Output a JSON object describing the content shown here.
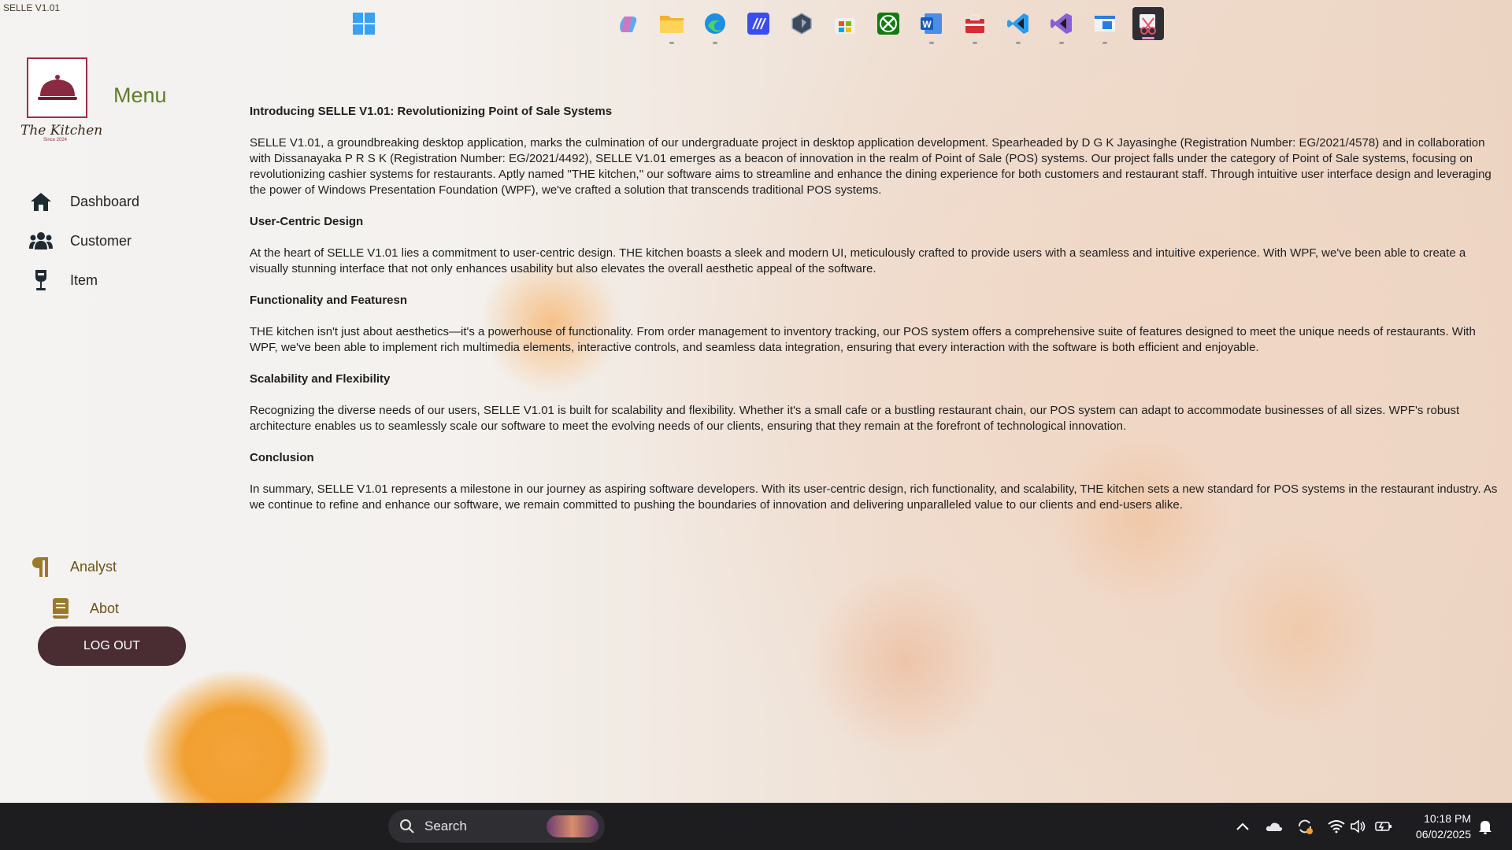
{
  "app": {
    "title": "SELLE V1.01"
  },
  "sidebar": {
    "logo_text": "The Kitchen",
    "logo_sub": "Since 2024",
    "menu_title": "Menu",
    "items": [
      {
        "label": "Dashboard",
        "icon": "home-icon"
      },
      {
        "label": "Customer",
        "icon": "users-icon"
      },
      {
        "label": "Item",
        "icon": "wine-glass-icon"
      }
    ],
    "bottom_items": [
      {
        "label": "Analyst",
        "icon": "paragraph-icon"
      },
      {
        "label": "Abot",
        "icon": "book-icon"
      }
    ],
    "logout_label": "LOG OUT"
  },
  "content": {
    "heading": "Introducing SELLE V1.01: Revolutionizing Point of Sale Systems",
    "intro": "SELLE V1.01, a groundbreaking desktop application, marks the culmination of our undergraduate project in desktop application development. Spearheaded by D G K Jayasinghe (Registration Number: EG/2021/4578) and in collaboration with Dissanayaka P R S K (Registration Number: EG/2021/4492), SELLE V1.01 emerges as a beacon of innovation in the realm of Point of Sale (POS) systems. Our project falls under the category of Point of Sale systems, focusing on revolutionizing cashier systems for restaurants. Aptly named \"THE kitchen,\" our software aims to streamline and enhance the dining experience for both customers and restaurant staff. Through intuitive user interface design and leveraging the power of Windows Presentation Foundation (WPF), we've crafted a solution that transcends traditional POS systems.",
    "sections": [
      {
        "title": "User-Centric Design",
        "body": "At the heart of SELLE V1.01 lies a commitment to user-centric design. THE kitchen boasts a sleek and modern UI, meticulously crafted to provide users with a seamless and intuitive experience. With WPF, we've been able to create a visually stunning interface that not only enhances usability but also elevates the overall aesthetic appeal of the software."
      },
      {
        "title": "Functionality and Featuresn",
        "body": "THE kitchen isn't just about aesthetics—it's a powerhouse of functionality. From order management to inventory tracking, our POS system offers a comprehensive suite of features designed to meet the unique needs of restaurants. With WPF, we've been able to implement rich multimedia elements, interactive controls, and seamless data integration, ensuring that every interaction with the software is both efficient and enjoyable."
      },
      {
        "title": "Scalability and Flexibility",
        "body": "Recognizing the diverse needs of our users, SELLE V1.01 is built for scalability and flexibility. Whether it's a small cafe or a bustling restaurant chain, our POS system can adapt to accommodate businesses of all sizes. WPF's robust architecture enables us to seamlessly scale our software to meet the evolving needs of our clients, ensuring that they remain at the forefront of technological innovation."
      },
      {
        "title": "Conclusion",
        "body": "In summary, SELLE V1.01 represents a milestone in our journey as aspiring software developers. With its user-centric design, rich functionality, and scalability, THE kitchen sets a new standard for POS systems in the restaurant industry. As we continue to refine and enhance our software, we remain committed to pushing the boundaries of innovation and delivering unparalleled value to our clients and end-users alike."
      }
    ]
  },
  "taskbar": {
    "search_label": "Search",
    "apps": [
      "copilot-icon",
      "file-explorer-icon",
      "edge-icon",
      "code-editor-icon",
      "settings-app-icon",
      "microsoft-store-icon",
      "xbox-icon",
      "word-icon",
      "toolbox-icon",
      "vscode-icon",
      "visual-studio-icon",
      "window-app-icon",
      "snipping-tool-icon"
    ],
    "tray": [
      "chevron-up-icon",
      "onedrive-icon",
      "sync-icon",
      "wifi-icon",
      "volume-icon",
      "battery-icon"
    ],
    "time": "10:18 PM",
    "date": "06/02/2025"
  },
  "colors": {
    "accent_green": "#5f7d2a",
    "logout_bg": "#4a2c33",
    "logo_border": "#9a2e48",
    "taskbar_bg": "#1d1d1f"
  }
}
